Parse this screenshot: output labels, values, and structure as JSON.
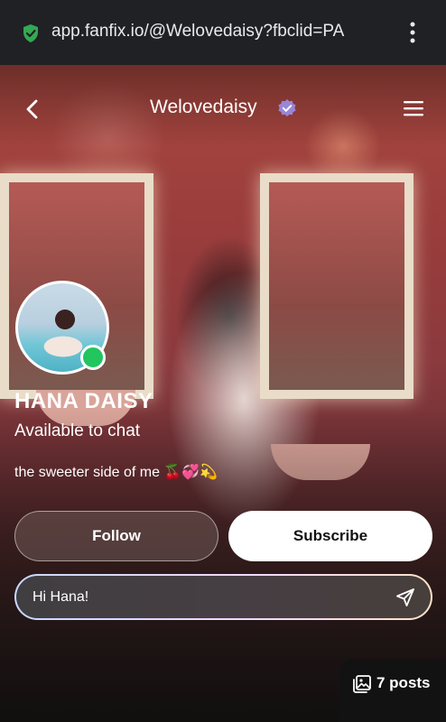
{
  "browser": {
    "url": "app.fanfix.io/@Welovedaisy?fbclid=PA",
    "lock_icon": "shield-lock-icon",
    "menu_icon": "kebab-menu-icon"
  },
  "header": {
    "back_icon": "chevron-left-icon",
    "handle": "Welovedaisy",
    "verified_icon": "verified-badge-icon",
    "menu_icon": "hamburger-menu-icon"
  },
  "profile": {
    "name": "HANA DAISY",
    "status": "Available to chat",
    "bio": "the sweeter side of me 🍒💞💫",
    "online_color": "#22c55e"
  },
  "actions": {
    "follow_label": "Follow",
    "subscribe_label": "Subscribe"
  },
  "chat": {
    "value": "Hi Hana!",
    "send_icon": "send-icon"
  },
  "posts": {
    "icon": "gallery-icon",
    "label": "7 posts"
  }
}
